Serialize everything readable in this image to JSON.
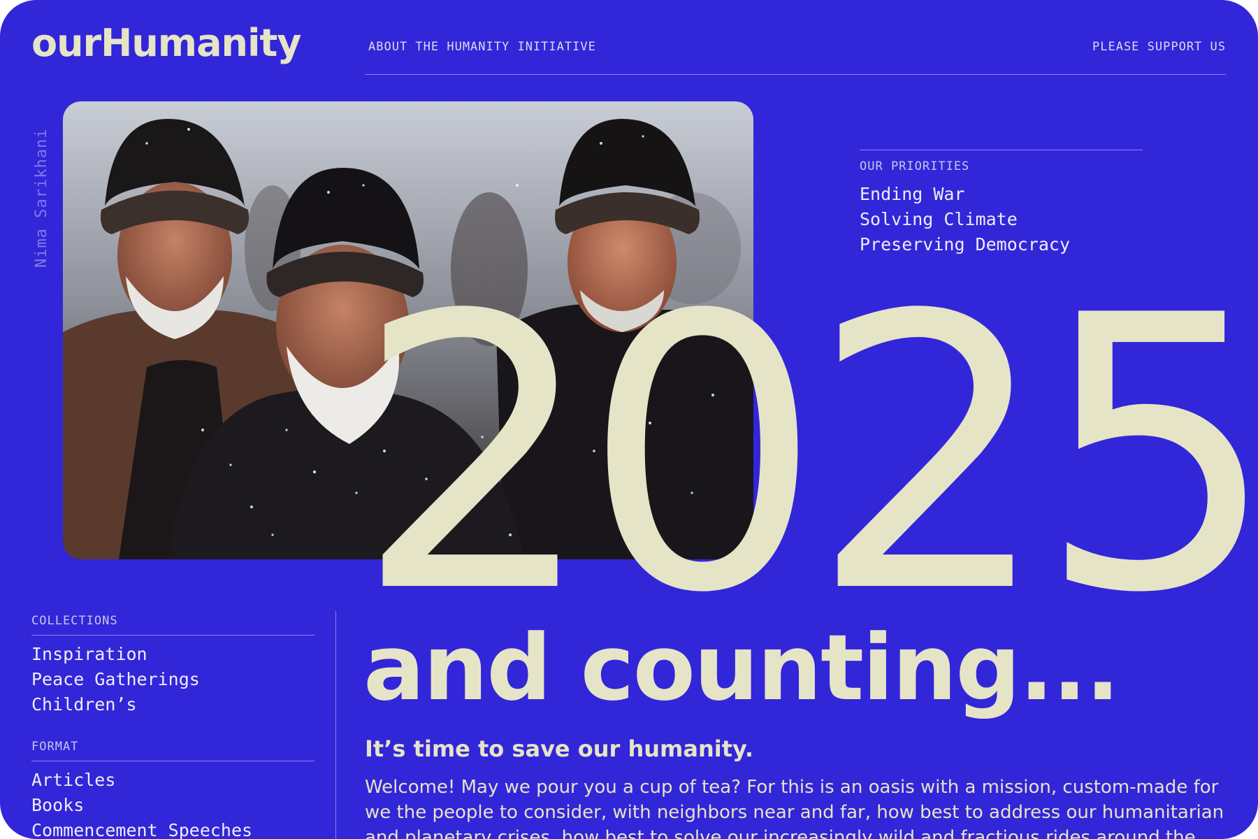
{
  "header": {
    "logo": "ourHumanity",
    "nav_about": "ABOUT THE HUMANITY INITIATIVE",
    "nav_support": "PLEASE SUPPORT US"
  },
  "photo": {
    "credit": "Nima Sarikhani"
  },
  "priorities": {
    "heading": "OUR PRIORITIES",
    "items": [
      "Ending War",
      "Solving Climate",
      "Preserving Democracy"
    ]
  },
  "hero": {
    "year": "2025",
    "headline": "and counting...",
    "tagline": "It’s time to save our humanity.",
    "intro": "Welcome! May we pour you a cup of tea? For this is an oasis with a mission, custom-made for we the people to consider, with neighbors near and far, how best to address our humanitarian and planetary crises, how best to solve our increasingly wild and fractious rides around the sun."
  },
  "sidebar": {
    "collections": {
      "heading": "COLLECTIONS",
      "items": [
        "Inspiration",
        "Peace Gatherings",
        "Children’s"
      ]
    },
    "format": {
      "heading": "FORMAT",
      "items": [
        "Articles",
        "Books",
        "Commencement Speeches"
      ]
    }
  },
  "colors": {
    "background": "#3226d9",
    "cream": "#e6e4c7",
    "rule": "#8b84ec"
  }
}
